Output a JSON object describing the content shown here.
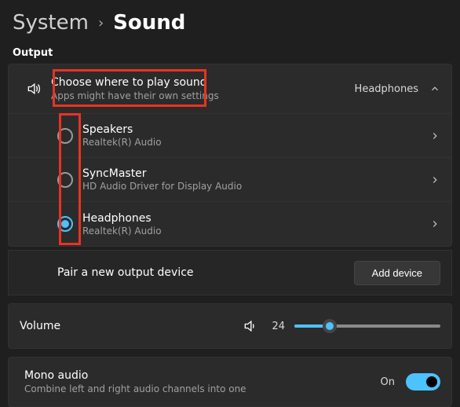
{
  "breadcrumb": {
    "parent": "System",
    "current": "Sound"
  },
  "section": {
    "output": "Output"
  },
  "choose": {
    "title": "Choose where to play sound",
    "subtitle": "Apps might have their own settings",
    "selected": "Headphones"
  },
  "devices": [
    {
      "name": "Speakers",
      "driver": "Realtek(R) Audio",
      "checked": false
    },
    {
      "name": "SyncMaster",
      "driver": "HD Audio Driver for Display Audio",
      "checked": false
    },
    {
      "name": "Headphones",
      "driver": "Realtek(R) Audio",
      "checked": true
    }
  ],
  "pair": {
    "label": "Pair a new output device",
    "button": "Add device"
  },
  "volume": {
    "label": "Volume",
    "value": 24,
    "min": 0,
    "max": 100
  },
  "mono": {
    "title": "Mono audio",
    "subtitle": "Combine left and right audio channels into one",
    "state_label": "On",
    "state": true
  }
}
